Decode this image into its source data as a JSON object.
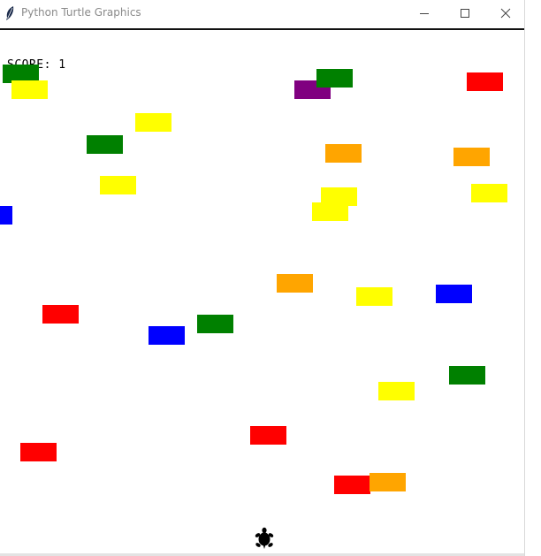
{
  "window": {
    "title": "Python Turtle Graphics",
    "title_icon": "feather-icon",
    "controls": [
      "minimize-icon",
      "maximize-icon",
      "close-icon"
    ]
  },
  "game": {
    "score_text": "SCORE: 1",
    "background": "#ffffff",
    "player": {
      "shape": "turtle",
      "color": "#000000"
    },
    "brick_colors": [
      "#008000",
      "#ffff00",
      "#800080",
      "#ff0000",
      "#ffa500",
      "#0000ff"
    ]
  }
}
